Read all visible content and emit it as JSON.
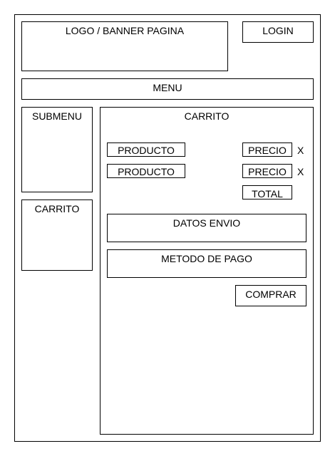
{
  "header": {
    "banner_label": "LOGO / BANNER PAGINA",
    "login_label": "LOGIN"
  },
  "menu": {
    "label": "MENU"
  },
  "sidebar": {
    "submenu_label": "SUBMENU",
    "cart_label": "CARRITO"
  },
  "cart": {
    "title": "CARRITO",
    "items": [
      {
        "product": "PRODUCTO",
        "price": "PRECIO",
        "remove": "X"
      },
      {
        "product": "PRODUCTO",
        "price": "PRECIO",
        "remove": "X"
      }
    ],
    "total_label": "TOTAL",
    "shipping_label": "DATOS ENVIO",
    "payment_label": "METODO DE PAGO",
    "buy_label": "COMPRAR"
  }
}
